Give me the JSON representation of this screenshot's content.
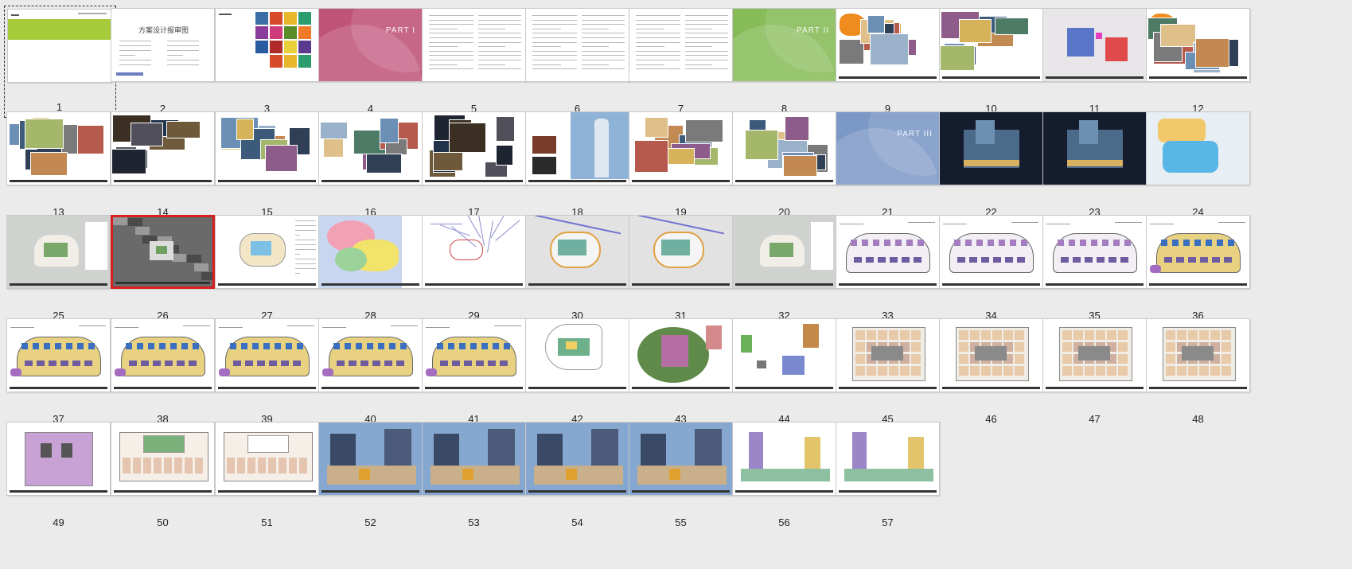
{
  "window": {
    "title": "slide sorter"
  },
  "selected_slide": "1",
  "active_slide": "26",
  "slides": [
    {
      "num": "1",
      "kind": "green-cover"
    },
    {
      "num": "2",
      "kind": "form",
      "title": "方案设计报审图"
    },
    {
      "num": "3",
      "kind": "collage-cover"
    },
    {
      "num": "4",
      "kind": "color-cover",
      "color": "#c05378",
      "label": "PART I"
    },
    {
      "num": "5",
      "kind": "text"
    },
    {
      "num": "6",
      "kind": "text"
    },
    {
      "num": "7",
      "kind": "text"
    },
    {
      "num": "8",
      "kind": "color-cover",
      "color": "#86bb57",
      "label": "PART II"
    },
    {
      "num": "9",
      "kind": "map-photos"
    },
    {
      "num": "10",
      "kind": "photos"
    },
    {
      "num": "11",
      "kind": "map-blocks"
    },
    {
      "num": "12",
      "kind": "map-photos2"
    },
    {
      "num": "13",
      "kind": "aerial-photos"
    },
    {
      "num": "14",
      "kind": "dark-photos"
    },
    {
      "num": "15",
      "kind": "photos"
    },
    {
      "num": "16",
      "kind": "photos"
    },
    {
      "num": "17",
      "kind": "dark-photos"
    },
    {
      "num": "18",
      "kind": "tower"
    },
    {
      "num": "19",
      "kind": "photos"
    },
    {
      "num": "20",
      "kind": "photos"
    },
    {
      "num": "21",
      "kind": "color-cover",
      "color": "#7c98c6",
      "label": "PART III"
    },
    {
      "num": "22",
      "kind": "night"
    },
    {
      "num": "23",
      "kind": "night"
    },
    {
      "num": "24",
      "kind": "blue-plan"
    },
    {
      "num": "25",
      "kind": "siteplan"
    },
    {
      "num": "26",
      "kind": "aerial-bw"
    },
    {
      "num": "27",
      "kind": "siteplan-light"
    },
    {
      "num": "28",
      "kind": "colorful-plan"
    },
    {
      "num": "29",
      "kind": "lineplan"
    },
    {
      "num": "30",
      "kind": "siteplan-lines"
    },
    {
      "num": "31",
      "kind": "siteplan-lines"
    },
    {
      "num": "32",
      "kind": "siteplan-grey"
    },
    {
      "num": "33",
      "kind": "floorplan-purple"
    },
    {
      "num": "34",
      "kind": "floorplan-purple"
    },
    {
      "num": "35",
      "kind": "floorplan-purple"
    },
    {
      "num": "36",
      "kind": "floorplan-yellow"
    },
    {
      "num": "37",
      "kind": "floorplan-yellow"
    },
    {
      "num": "38",
      "kind": "floorplan-yellow"
    },
    {
      "num": "39",
      "kind": "floorplan-yellow"
    },
    {
      "num": "40",
      "kind": "floorplan-yellow"
    },
    {
      "num": "41",
      "kind": "floorplan-yellow"
    },
    {
      "num": "42",
      "kind": "small-plan"
    },
    {
      "num": "43",
      "kind": "green-plan"
    },
    {
      "num": "44",
      "kind": "scatter-plan"
    },
    {
      "num": "45",
      "kind": "floorplan-brown"
    },
    {
      "num": "46",
      "kind": "floorplan-brown"
    },
    {
      "num": "47",
      "kind": "floorplan-brown"
    },
    {
      "num": "48",
      "kind": "floorplan-brown"
    },
    {
      "num": "49",
      "kind": "lilac-plan"
    },
    {
      "num": "50",
      "kind": "green-floor"
    },
    {
      "num": "51",
      "kind": "white-floor"
    },
    {
      "num": "52",
      "kind": "elevation"
    },
    {
      "num": "53",
      "kind": "elevation"
    },
    {
      "num": "54",
      "kind": "elevation"
    },
    {
      "num": "55",
      "kind": "elevation"
    },
    {
      "num": "56",
      "kind": "section"
    },
    {
      "num": "57",
      "kind": "section"
    }
  ]
}
